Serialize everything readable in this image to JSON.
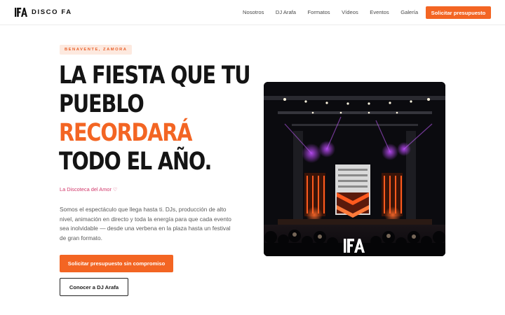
{
  "brand": {
    "name": "DISCO FA",
    "logo_text": "FA"
  },
  "nav": {
    "items": [
      {
        "label": "Nosotros"
      },
      {
        "label": "DJ Arafa"
      },
      {
        "label": "Formatos"
      },
      {
        "label": "Vídeos"
      },
      {
        "label": "Eventos"
      },
      {
        "label": "Galería"
      }
    ],
    "cta_label": "Solicitar presupuesto"
  },
  "hero": {
    "badge": "BENAVENTE, ZAMORA",
    "headline": {
      "line1": "LA FIESTA QUE TU",
      "line2": "PUEBLO",
      "line3": "RECORDARÁ",
      "line4": "TODO EL AÑO."
    },
    "tagline": "La Discoteca del Amor",
    "tagline_icon": "heart-icon",
    "description": "Somos el espectáculo que llega hasta ti. DJs, producción de alto nivel, animación en directo y toda la energía para que cada evento sea inolvidable — desde una verbena en la plaza hasta un festival de gran formato.",
    "primary_button": "Solicitar presupuesto sin compromiso",
    "secondary_button": "Conocer a DJ Arafa"
  },
  "image": {
    "subject": "stage-photo",
    "overlay_logo": "FA"
  },
  "colors": {
    "accent": "#f36523",
    "tagline": "#d1376a",
    "badge_bg": "#fde9df",
    "text_dark": "#141414"
  }
}
